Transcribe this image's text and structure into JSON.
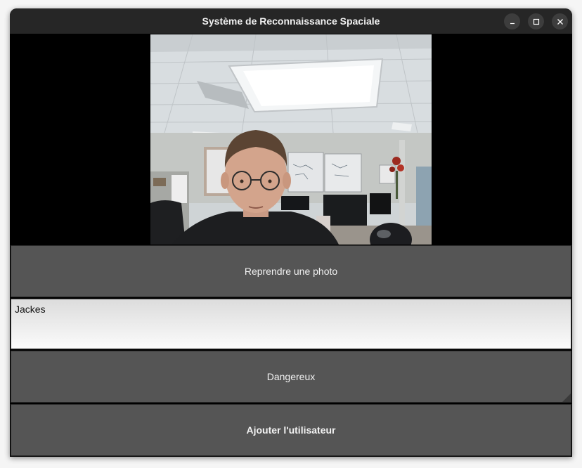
{
  "window": {
    "title": "Système de Reconnaissance Spaciale"
  },
  "camera": {
    "description_icon": "camera-feed"
  },
  "buttons": {
    "retake_label": "Reprendre une photo",
    "danger_label": "Dangereux",
    "add_user_label": "Ajouter l'utilisateur"
  },
  "name_input": {
    "value": "Jackes"
  },
  "colors": {
    "titlebar": "#262626",
    "button_bg": "#555555",
    "background": "#000000"
  }
}
